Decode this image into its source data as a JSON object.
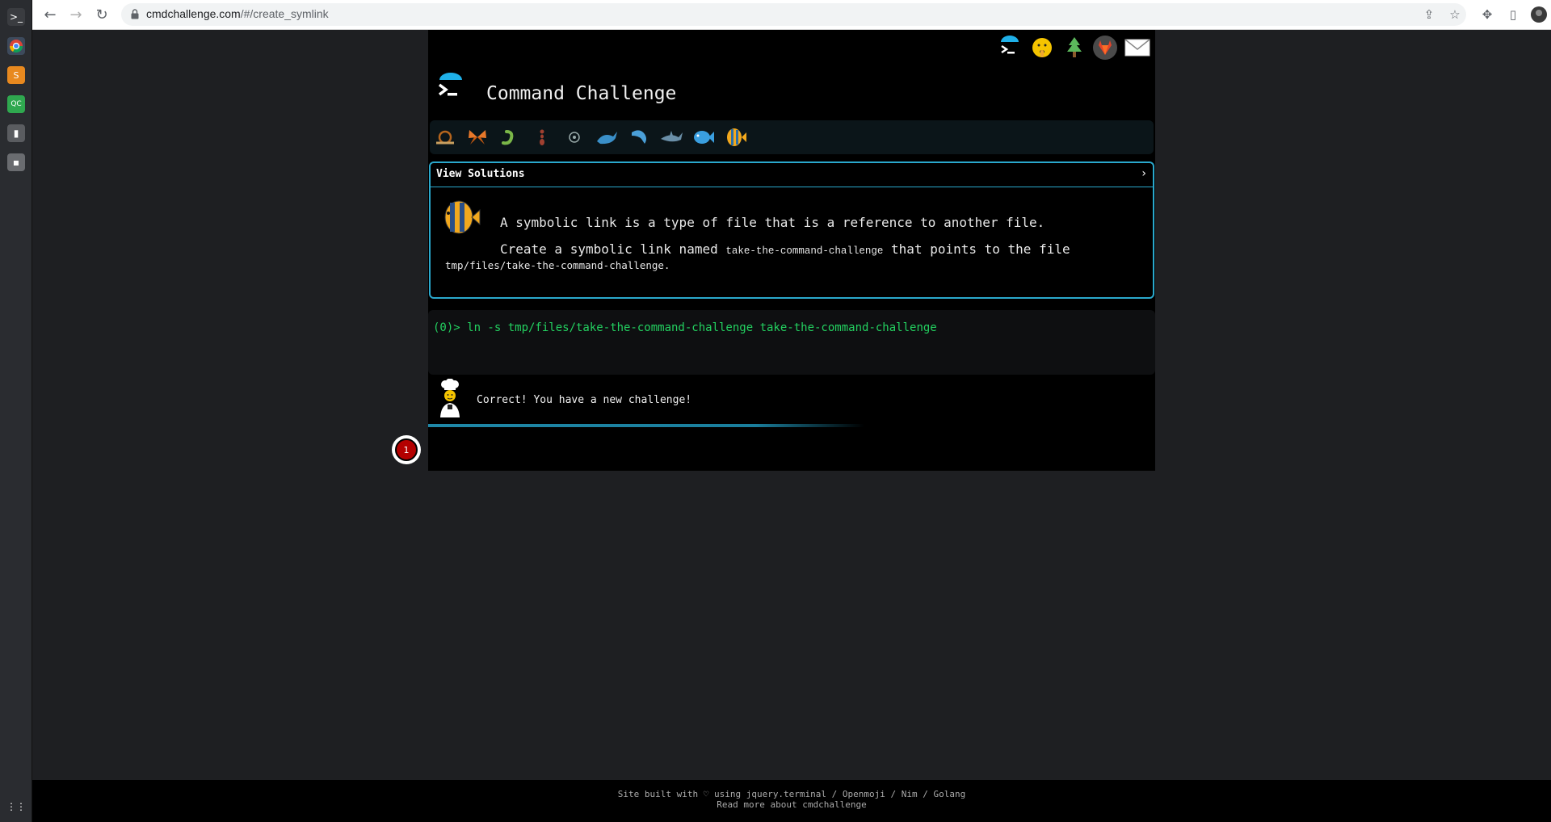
{
  "browser": {
    "url_domain": "cmdchallenge.com",
    "url_path": "/#/create_symlink"
  },
  "header": {
    "title": "Command Challenge"
  },
  "challenge": {
    "view_solutions_label": "View Solutions",
    "chevron": "›",
    "description_line1": "A symbolic link is a type of file that is a reference to another file.",
    "description_line2_prefix": "Create a symbolic link named ",
    "description_line2_code": "take-the-command-challenge",
    "description_line2_suffix": " that points to the file",
    "description_line3": "tmp/files/take-the-command-challenge."
  },
  "terminal": {
    "prompt": "(0)> ln -s tmp/files/take-the-command-challenge take-the-command-challenge"
  },
  "response": {
    "message": "Correct! You have a new challenge!"
  },
  "notification_badge": {
    "count": "1"
  },
  "footer": {
    "line1_prefix": "Site built with ",
    "heart": "♡",
    "line1_suffix": " using jquery.terminal / Openmoji / Nim / Golang",
    "line2": "Read more about cmdchallenge"
  },
  "colors": {
    "accent": "#2aa8cc",
    "prompt_green": "#23d160",
    "badge_red": "#b30000"
  },
  "level_icons": [
    "snail-icon",
    "butterfly-icon",
    "worm-icon",
    "ant-icon",
    "microbe-icon",
    "whale-icon",
    "dolphin-icon",
    "shark-icon",
    "fish-icon",
    "tropical-fish-icon"
  ]
}
